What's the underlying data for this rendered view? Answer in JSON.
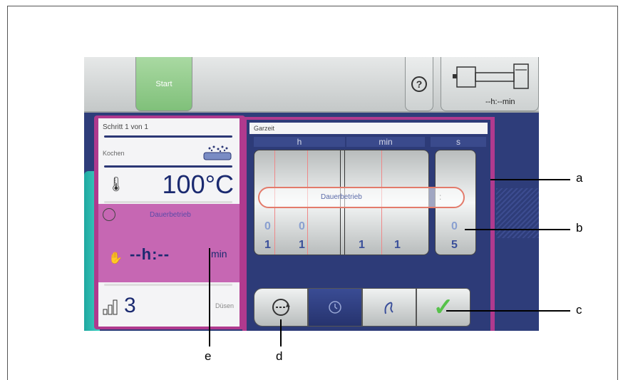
{
  "topbar": {
    "start_label": "Start",
    "help_label": "?",
    "machine_time": "--h:--min"
  },
  "left_panel": {
    "step_text": "Schritt  1  von  1",
    "mode_label": "Kochen",
    "temperature": "100°C",
    "duration_mode": "Dauerbetrieb",
    "time_value": "--h:--",
    "time_unit": "min",
    "level_value": "3",
    "level_label": "Düsen"
  },
  "right_panel": {
    "title": "Garzeit",
    "columns": [
      "h",
      "min",
      "s"
    ],
    "top_digits": [
      "0",
      "0"
    ],
    "top_s_digit": "0",
    "bottom_digits": [
      "1",
      "1",
      "1",
      "1"
    ],
    "bottom_s_digit": "5",
    "selection_text": "Dauerbetrieb",
    "selection_colon": ":"
  },
  "mode_buttons": [
    "duration-cycle-icon",
    "clock-icon",
    "probe-icon",
    "check-icon"
  ],
  "callouts": {
    "a": "a",
    "b": "b",
    "c": "c",
    "d": "d",
    "e": "e"
  },
  "colors": {
    "frame_magenta": "#b03a8e",
    "screen_blue": "#2e3d7a",
    "confirm_green": "#56c24a",
    "highlight_pink": "#c667b3"
  }
}
